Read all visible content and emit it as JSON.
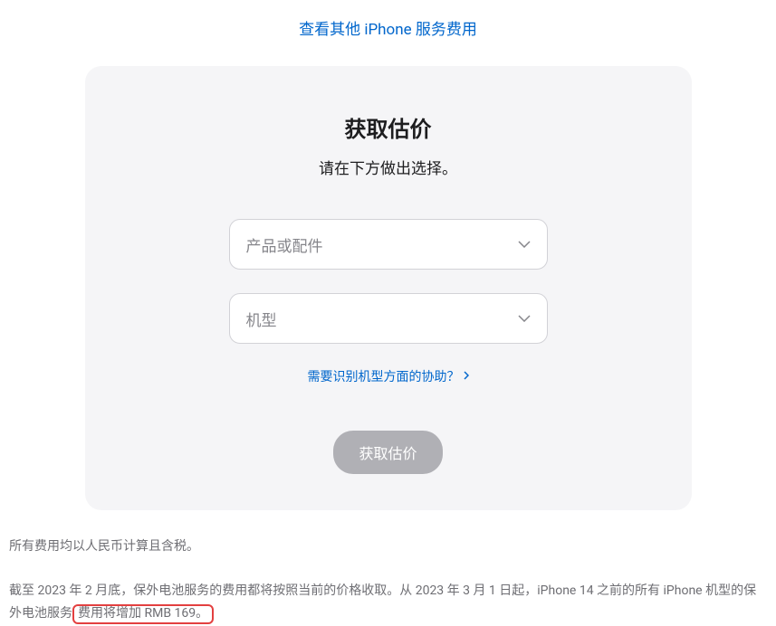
{
  "topLink": {
    "text": "查看其他 iPhone 服务费用"
  },
  "card": {
    "title": "获取估价",
    "subtitle": "请在下方做出选择。",
    "select1": "产品或配件",
    "select2": "机型",
    "helpLink": "需要识别机型方面的协助？",
    "button": "获取估价"
  },
  "footer": {
    "line1": "所有费用均以人民币计算且含税。",
    "line2_pre": "截至 2023 年 2 月底，保外电池服务的费用都将按照当前的价格收取。从 2023 年 3 月 1 日起，iPhone 14 之前的所有 iPhone 机型的保外电池服务",
    "line2_highlight": "费用将增加 RMB 169。"
  }
}
